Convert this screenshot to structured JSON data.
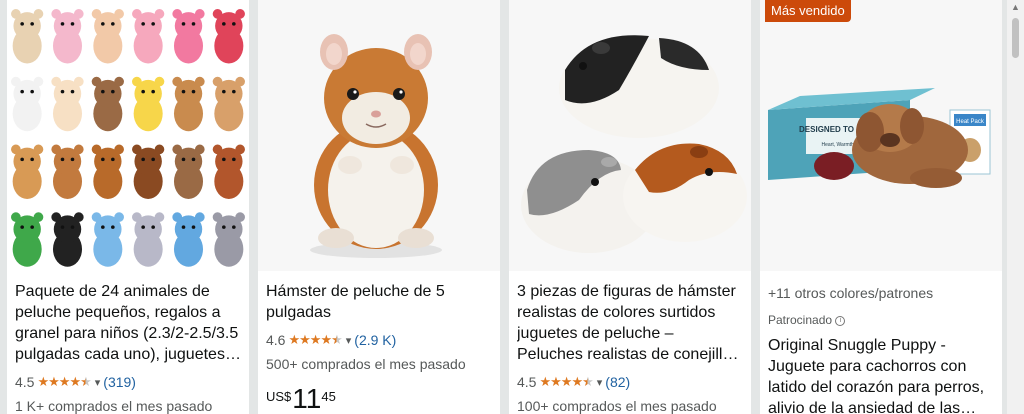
{
  "products": [
    {
      "title": "Paquete de 24 animales de peluche pequeños, regalos a granel para niños (2.3/2-2.5/3.5 pulgadas cada uno), juguetes de peluche de animales",
      "rating": "4.5",
      "rating_value": 4.5,
      "review_count": "(319)",
      "bought": "1 K+ comprados el mes pasado"
    },
    {
      "title": "Hámster de peluche de 5 pulgadas",
      "rating": "4.6",
      "rating_value": 4.6,
      "review_count": "(2.9 K)",
      "bought": "500+ comprados el mes pasado",
      "price": {
        "currency": "US$",
        "whole": "11",
        "fraction": "45"
      }
    },
    {
      "title": "3 piezas de figuras de hámster realistas de colores surtidos juguetes de peluche – Peluches realistas de conejillo de indias, regalos",
      "rating": "4.5",
      "rating_value": 4.5,
      "review_count": "(82)",
      "bought": "100+ comprados el mes pasado"
    },
    {
      "badge": "Más vendido",
      "variants": "+11 otros colores/patrones",
      "sponsored": "Patrocinado",
      "title": "Original Snuggle Puppy - Juguete para cachorros con latido del corazón para perros, alivio de la ansiedad de las mascotas",
      "box_text": "DESIGNED TO CALM YO",
      "box_sub": "Heart, Warmth & Com",
      "heat_pack_label": "Heat Pack"
    }
  ],
  "colors": {
    "star": "#de7921",
    "link": "#2162a1",
    "badge": "#cc4a0a"
  }
}
